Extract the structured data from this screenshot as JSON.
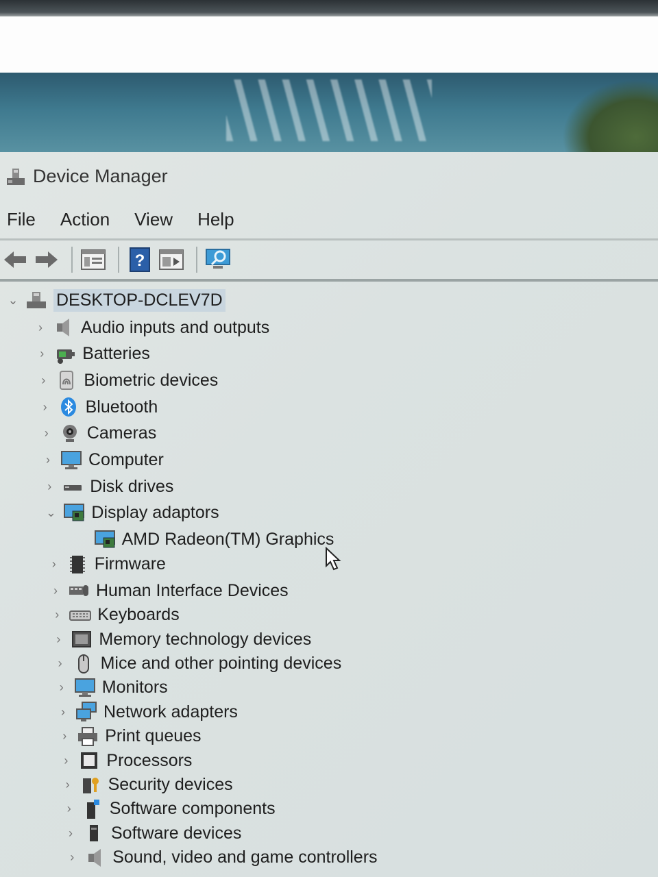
{
  "window": {
    "title": "Device Manager"
  },
  "menu": [
    "File",
    "Action",
    "View",
    "Help"
  ],
  "toolbar": [
    "back-icon",
    "forward-icon",
    "properties-icon",
    "help-icon",
    "update-driver-icon",
    "scan-hardware-icon"
  ],
  "tree": {
    "root": {
      "label": "DESKTOP-DCLEV7D",
      "expanded": true,
      "icon": "computer-tree-icon"
    },
    "categories": [
      {
        "label": "Audio inputs and outputs",
        "icon": "speaker-icon",
        "expanded": false
      },
      {
        "label": "Batteries",
        "icon": "battery-icon",
        "expanded": false
      },
      {
        "label": "Biometric devices",
        "icon": "fingerprint-icon",
        "expanded": false
      },
      {
        "label": "Bluetooth",
        "icon": "bluetooth-icon",
        "expanded": false
      },
      {
        "label": "Cameras",
        "icon": "camera-icon",
        "expanded": false
      },
      {
        "label": "Computer",
        "icon": "monitor-icon",
        "expanded": false
      },
      {
        "label": "Disk drives",
        "icon": "disk-drive-icon",
        "expanded": false
      },
      {
        "label": "Display adaptors",
        "icon": "display-adapter-icon",
        "expanded": true,
        "children": [
          {
            "label": "AMD Radeon(TM) Graphics",
            "icon": "display-adapter-icon"
          }
        ]
      },
      {
        "label": "Firmware",
        "icon": "firmware-icon",
        "expanded": false
      },
      {
        "label": "Human Interface Devices",
        "icon": "hid-icon",
        "expanded": false
      },
      {
        "label": "Keyboards",
        "icon": "keyboard-icon",
        "expanded": false
      },
      {
        "label": "Memory technology devices",
        "icon": "memory-icon",
        "expanded": false
      },
      {
        "label": "Mice and other pointing devices",
        "icon": "mouse-icon",
        "expanded": false
      },
      {
        "label": "Monitors",
        "icon": "monitor-icon",
        "expanded": false
      },
      {
        "label": "Network adapters",
        "icon": "network-icon",
        "expanded": false
      },
      {
        "label": "Print queues",
        "icon": "printer-icon",
        "expanded": false
      },
      {
        "label": "Processors",
        "icon": "processor-icon",
        "expanded": false
      },
      {
        "label": "Security devices",
        "icon": "security-icon",
        "expanded": false
      },
      {
        "label": "Software components",
        "icon": "software-component-icon",
        "expanded": false
      },
      {
        "label": "Software devices",
        "icon": "software-device-icon",
        "expanded": false
      },
      {
        "label": "Sound, video and game controllers",
        "icon": "speaker-icon",
        "expanded": false
      }
    ]
  },
  "colors": {
    "window_bg": "#dde3e2",
    "selection": "#c9d6df",
    "text": "#1e1e1e",
    "accent": "#2b6fb8"
  }
}
